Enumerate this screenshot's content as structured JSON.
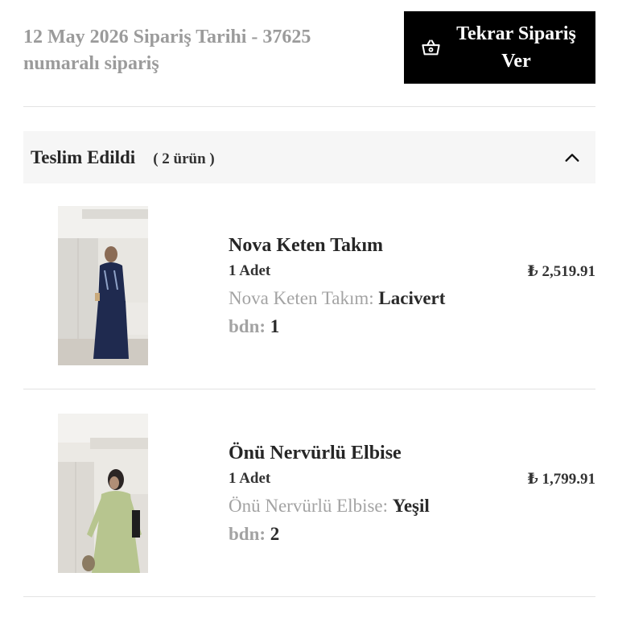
{
  "order": {
    "title": "12 May 2026 Sipariş Tarihi - 37625 numaralı sipariş",
    "reorder_label": "Tekrar Sipariş Ver",
    "reorder_icon": "basket-icon"
  },
  "status": {
    "label": "Teslim Edildi",
    "count": "( 2 ürün )",
    "toggle_icon": "chevron-up-icon"
  },
  "items": [
    {
      "name": "Nova Keten Takım",
      "qty": "1 Adet",
      "price": "₺ 2,519.91",
      "variant_key": "Nova Keten Takım:",
      "variant_value": "Lacivert",
      "bdn_key": "bdn:",
      "bdn_value": "1",
      "garment_color": "#1f2a4f"
    },
    {
      "name": "Önü Nervürlü Elbise",
      "qty": "1 Adet",
      "price": "₺ 1,799.91",
      "variant_key": "Önü Nervürlü Elbise:",
      "variant_value": "Yeşil",
      "bdn_key": "bdn:",
      "bdn_value": "2",
      "garment_color": "#b7c58f"
    }
  ]
}
